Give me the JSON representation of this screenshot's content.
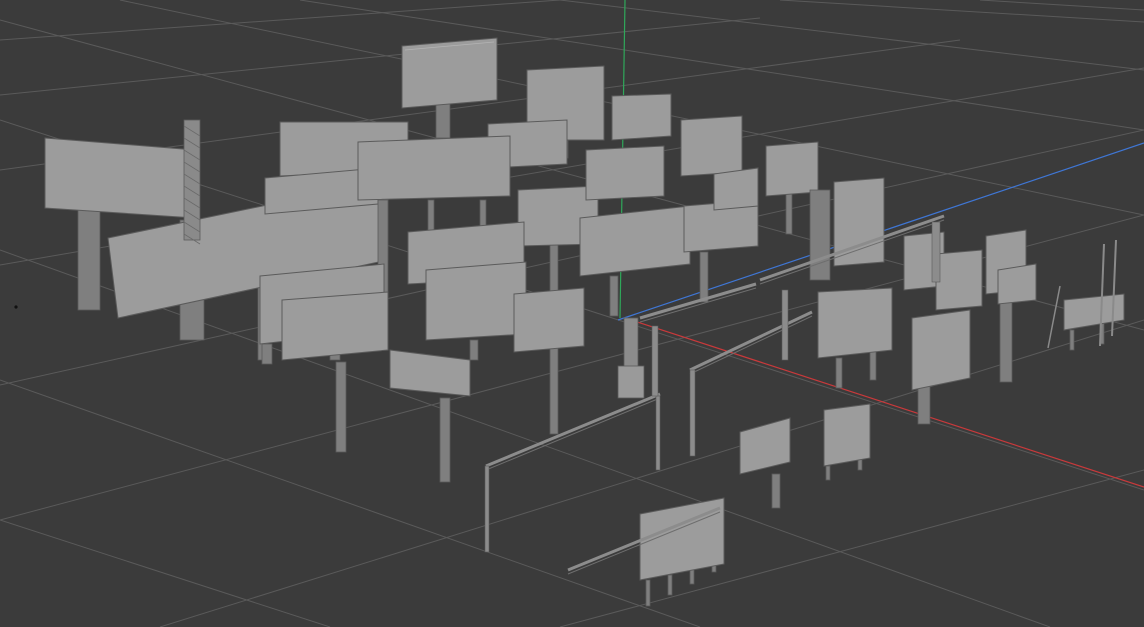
{
  "viewport": {
    "background": "#3b3b3b",
    "grid_color": "#5a5a5a",
    "axis_x_color": "#c8393b",
    "axis_y_color": "#2fa85a",
    "axis_z_color": "#3f76d4",
    "model_fill": "#9c9c9c",
    "model_side": "#7f7f7f",
    "model_edge": "#5b5b5b"
  },
  "scene": {
    "object_type": "billboard-icon",
    "origin_marker": "origin-point-icon"
  }
}
